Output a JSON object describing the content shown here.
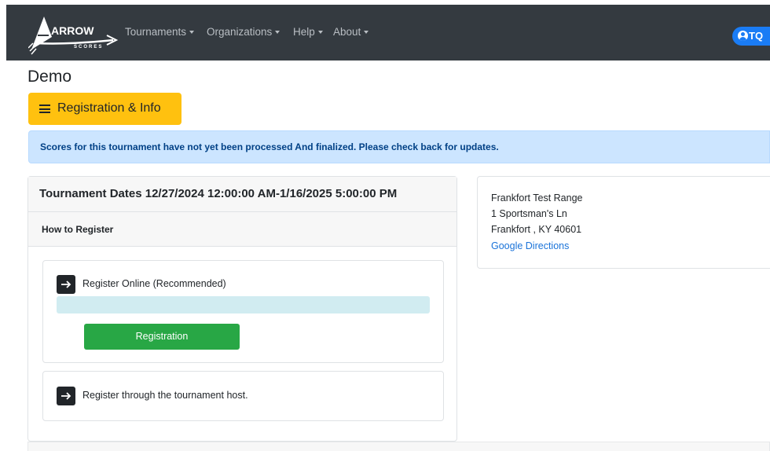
{
  "navbar": {
    "logo": {
      "title": "ARROW",
      "subtitle": "SCORES"
    },
    "menu": [
      {
        "label": "Tournaments"
      },
      {
        "label": "Organizations"
      },
      {
        "label": "Help"
      },
      {
        "label": "About"
      }
    ],
    "user": {
      "label": "TQ"
    }
  },
  "page": {
    "title": "Demo"
  },
  "registration_button": {
    "label": "Registration & Info"
  },
  "alert": {
    "text": "Scores for this tournament have not yet been processed And finalized. Please check back for updates."
  },
  "tournament": {
    "dates_heading": "Tournament Dates 12/27/2024 12:00:00 AM-1/16/2025 5:00:00 PM",
    "how_to_register": "How to Register",
    "options": [
      {
        "label": "Register Online (Recommended)",
        "button": "Registration"
      },
      {
        "label": "Register through the tournament host."
      }
    ]
  },
  "location": {
    "name": "Frankfort Test Range",
    "street": "1 Sportsman's Ln",
    "city_state_zip": "Frankfort , KY 40601",
    "directions_link": "Google Directions"
  },
  "colors": {
    "navbar": "#343a40",
    "warning": "#ffc10f",
    "info_alert": "#cce5ff",
    "success": "#28a745",
    "primary": "#1a7cf5"
  }
}
